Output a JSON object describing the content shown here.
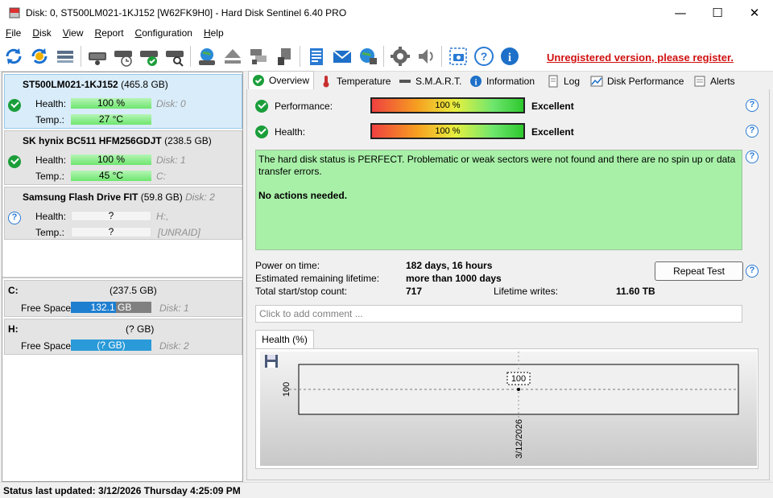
{
  "window": {
    "title": "Disk: 0, ST500LM021-1KJ152 [W62FK9H0]  -  Hard Disk Sentinel 6.40 PRO",
    "minimize": "—",
    "maximize": "☐",
    "close": "✕"
  },
  "menu": [
    "File",
    "Disk",
    "View",
    "Report",
    "Configuration",
    "Help"
  ],
  "toolbar": {
    "icons": [
      "refresh-icon",
      "refresh-all-icon",
      "disk-list-icon",
      "disk-info-icon",
      "disk-schedule-icon",
      "disk-test-icon",
      "disk-search-icon",
      "globe-disk-icon",
      "eject-icon",
      "network-disk-icon",
      "usb-disk-icon",
      "report-icon",
      "email-icon",
      "web-report-icon",
      "gear-icon",
      "speaker-icon",
      "screenshot-icon",
      "help-icon",
      "info-icon"
    ],
    "register_text": "Unregistered version, please register."
  },
  "disks": [
    {
      "name": "ST500LM021-1KJ152",
      "size": "(465.8 GB)",
      "health_label": "Health:",
      "health": "100 %",
      "health_percent": 100,
      "disk_label": "Disk: 0",
      "temp_label": "Temp.:",
      "temp": "27 °C",
      "volume": "",
      "status": "ok"
    },
    {
      "name": "SK hynix BC511 HFM256GDJT",
      "size": "(238.5 GB)",
      "health_label": "Health:",
      "health": "100 %",
      "health_percent": 100,
      "disk_label": "Disk: 1",
      "temp_label": "Temp.:",
      "temp": "45 °C",
      "volume": "C:",
      "status": "ok"
    },
    {
      "name": "Samsung Flash Drive FIT",
      "size": "(59.8 GB)",
      "disk_label": "Disk: 2",
      "health_label": "Health:",
      "health": "?",
      "temp_label": "Temp.:",
      "temp": "?",
      "volume": "H:,",
      "raid": "[UNRAID]",
      "status": "unknown"
    }
  ],
  "volumes": [
    {
      "letter": "C:",
      "size": "(237.5 GB)",
      "free_label": "Free Space",
      "free": "132.1 GB",
      "free_percent": 56,
      "disk_label": "Disk: 1"
    },
    {
      "letter": "H:",
      "size": "(? GB)",
      "free_label": "Free Space",
      "free": "(? GB)",
      "free_percent": 100,
      "disk_label": "Disk: 2"
    }
  ],
  "tabs": [
    "Overview",
    "Temperature",
    "S.M.A.R.T.",
    "Information",
    "Log",
    "Disk Performance",
    "Alerts"
  ],
  "overview": {
    "performance_label": "Performance:",
    "performance_value": "100 %",
    "performance_percent": 100,
    "performance_rating": "Excellent",
    "health_label": "Health:",
    "health_value": "100 %",
    "health_percent": 100,
    "health_rating": "Excellent",
    "status_text": "The hard disk status is PERFECT. Problematic or weak sectors were not found and there are no spin up or data transfer errors.",
    "status_action": "No actions needed.",
    "power_on_label": "Power on time:",
    "power_on_value": "182 days, 16 hours",
    "lifetime_label": "Estimated remaining lifetime:",
    "lifetime_value": "more than 1000 days",
    "startstop_label": "Total start/stop count:",
    "startstop_value": "717",
    "writes_label": "Lifetime writes:",
    "writes_value": "11.60 TB",
    "repeat_button": "Repeat Test",
    "comment_placeholder": "Click to add comment ...",
    "graph_tab": "Health (%)"
  },
  "chart_data": {
    "type": "line",
    "x": [
      "3/12/2026"
    ],
    "series": [
      {
        "values": [
          100
        ]
      }
    ],
    "data_labels": [
      "100"
    ],
    "ytick": "100"
  },
  "statusbar": {
    "text": "Status last updated: 3/12/2026 Thursday 4:25:09 PM"
  }
}
